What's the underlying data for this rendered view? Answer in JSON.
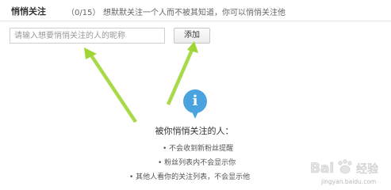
{
  "header": {
    "title": "悄悄关注",
    "count": "（0/15）",
    "description": "想默默关注一个人而不被其知道，你可以悄悄关注他"
  },
  "search": {
    "placeholder": "请输入想要悄悄关注的人的昵称"
  },
  "add_button_label": "添加",
  "info": {
    "icon_glyph": "i",
    "heading": "被你悄悄关注的人：",
    "notes": [
      "• 不会收到新粉丝提醒",
      "• 粉丝列表内不会显示你",
      "• 其他人看你的关注列表，不会显示他"
    ]
  },
  "watermark": {
    "text": "Bai 经验",
    "url": "jingyan.baidu.com"
  },
  "colors": {
    "arrow": "#9fd534",
    "info_icon": "#4aa3df"
  }
}
